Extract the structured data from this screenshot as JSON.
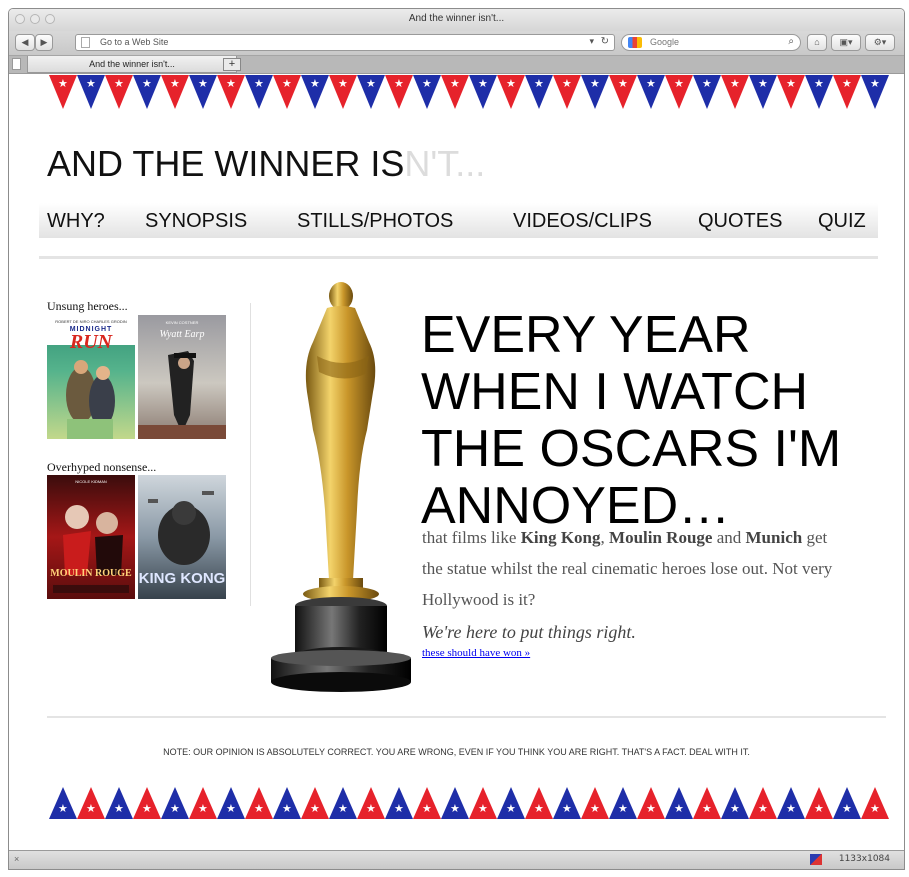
{
  "window": {
    "title": "And the winner isn't..."
  },
  "toolbar": {
    "url_placeholder": "Go to a Web Site",
    "search_placeholder": "Google"
  },
  "tabs": [
    {
      "label": "And the winner isn't...",
      "active": true
    }
  ],
  "status": {
    "size_readout": "1133x1084"
  },
  "page": {
    "title_main": "AND THE WINNER IS",
    "title_faded": "N'T...",
    "nav": [
      "WHY?",
      "SYNOPSIS",
      "STILLS/PHOTOS",
      "VIDEOS/CLIPS",
      "QUOTES",
      "QUIZ"
    ],
    "sidebar": {
      "unsung_label": "Unsung heroes...",
      "unsung_posters": [
        {
          "title": "MIDNIGHT RUN",
          "credit": "ROBERT DE NIRO  CHARLES GRODIN",
          "title_accent": "RUN"
        },
        {
          "title": "Wyatt Earp",
          "credit": "KEVIN COSTNER"
        }
      ],
      "overhyped_label": "Overhyped nonsense...",
      "overhyped_posters": [
        {
          "title": "MOULIN ROUGE",
          "credit": "NICOLE KIDMAN"
        },
        {
          "title": "KING KONG",
          "credit": ""
        }
      ]
    },
    "headline": "EVERY YEAR WHEN I WATCH THE OSCARS I'M ANNOYED…",
    "body": {
      "line1_pre": "that films like ",
      "film1": "King Kong",
      "sep1": ", ",
      "film2": "Moulin Rouge",
      "sep2": " and ",
      "film3": "Munich",
      "line1_post": " get",
      "line2": "the statue whilst the real cinematic heroes lose out. Not very",
      "line3": "Hollywood is it?"
    },
    "tagline": "We're here to put things right.",
    "link": "these should have won »",
    "footer_note": "NOTE: OUR OPINION IS ABSOLUTELY CORRECT. YOU ARE WRONG, EVEN IF YOU THINK YOU ARE RIGHT. THAT'S A FACT. DEAL WITH IT."
  },
  "colors": {
    "bunting_red": "#e6222b",
    "bunting_blue": "#1e2ea8",
    "oscar_gold": "#d4a72a"
  }
}
